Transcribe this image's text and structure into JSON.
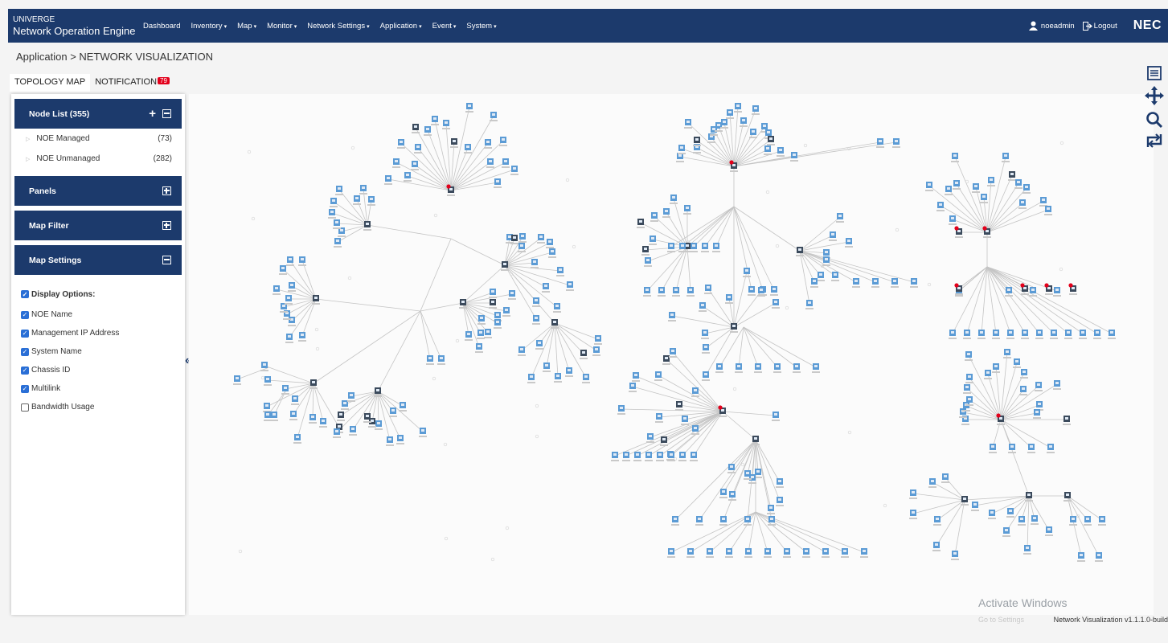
{
  "header": {
    "brand_small": "UNIVERGE",
    "brand_main": "Network Operation Engine",
    "nav": [
      {
        "label": "Dashboard",
        "caret": false
      },
      {
        "label": "Inventory",
        "caret": true
      },
      {
        "label": "Map",
        "caret": true
      },
      {
        "label": "Monitor",
        "caret": true
      },
      {
        "label": "Network Settings",
        "caret": true
      },
      {
        "label": "Application",
        "caret": true
      },
      {
        "label": "Event",
        "caret": true
      },
      {
        "label": "System",
        "caret": true
      }
    ],
    "user": "noeadmin",
    "logout": "Logout",
    "logo": "NEC"
  },
  "breadcrumb": "Application > NETWORK VISUALIZATION",
  "tabs": {
    "topology": "TOPOLOGY MAP",
    "notification": "NOTIFICATION",
    "notification_count": "79"
  },
  "sidebar": {
    "node_list": {
      "title": "Node List (355)",
      "items": [
        {
          "label": "NOE Managed",
          "count": "(73)"
        },
        {
          "label": "NOE Unmanaged",
          "count": "(282)"
        }
      ]
    },
    "panels_title": "Panels",
    "map_filter_title": "Map Filter",
    "map_settings_title": "Map Settings",
    "display_options_label": "Display Options:",
    "options": [
      {
        "label": "NOE Name",
        "checked": true
      },
      {
        "label": "Management IP Address",
        "checked": true
      },
      {
        "label": "System Name",
        "checked": true
      },
      {
        "label": "Chassis ID",
        "checked": true
      },
      {
        "label": "Multilink",
        "checked": true
      },
      {
        "label": "Bandwidth Usage",
        "checked": false
      }
    ]
  },
  "map_tools": [
    "menu-icon",
    "pan-icon",
    "search-icon",
    "refresh-icon"
  ],
  "colors": {
    "header": "#1c3a6c",
    "node_unmanaged": "#5b9bd5",
    "node_managed": "#3b4a5c",
    "alarm": "#e3001b",
    "link": "#c4c4c4"
  },
  "footer": {
    "watermark": "Activate Windows",
    "watermark_sub": "Go to Settings",
    "version": "Network Visualization v1.1.1.0-build"
  }
}
